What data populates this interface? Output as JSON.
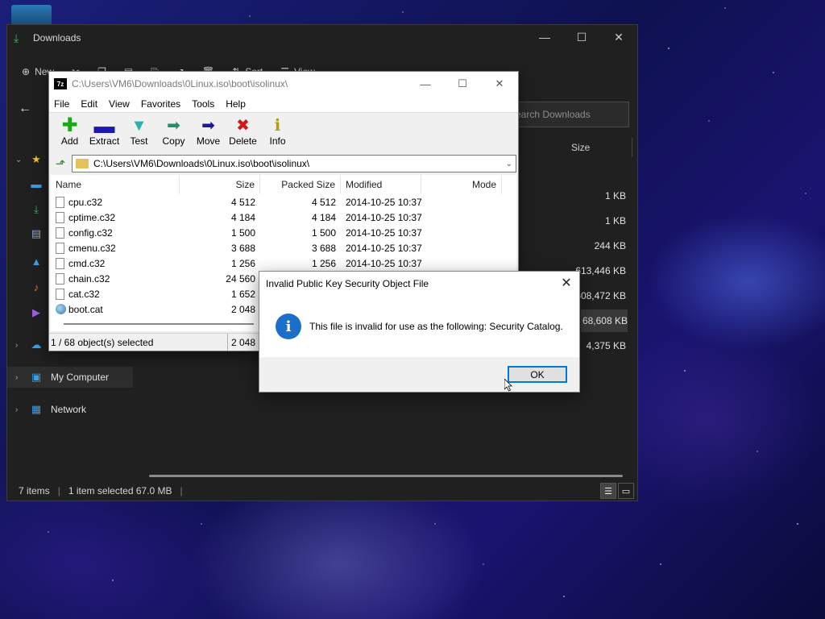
{
  "explorer": {
    "title": "Downloads",
    "toolbar": {
      "new_label": "New",
      "sort_label": "Sort",
      "view_label": "View"
    },
    "search_placeholder": "Search Downloads",
    "column_size": "Size",
    "sidebar": {
      "my_computer": "My Computer",
      "network": "Network"
    },
    "sizes": [
      "1 KB",
      "1 KB",
      "244 KB",
      "613,446 KB",
      "608,472 KB",
      "68,608 KB",
      "4,375 KB"
    ],
    "status": {
      "items": "7 items",
      "selected": "1 item selected  67.0 MB"
    }
  },
  "zip": {
    "title": "C:\\Users\\VM6\\Downloads\\0Linux.iso\\boot\\isolinux\\",
    "menu": [
      "File",
      "Edit",
      "View",
      "Favorites",
      "Tools",
      "Help"
    ],
    "tools": [
      "Add",
      "Extract",
      "Test",
      "Copy",
      "Move",
      "Delete",
      "Info"
    ],
    "address": "C:\\Users\\VM6\\Downloads\\0Linux.iso\\boot\\isolinux\\",
    "columns": [
      "Name",
      "Size",
      "Packed Size",
      "Modified",
      "Mode"
    ],
    "rows": [
      [
        "cpu.c32",
        "4 512",
        "4 512",
        "2014-10-25 10:37"
      ],
      [
        "cptime.c32",
        "4 184",
        "4 184",
        "2014-10-25 10:37"
      ],
      [
        "config.c32",
        "1 500",
        "1 500",
        "2014-10-25 10:37"
      ],
      [
        "cmenu.c32",
        "3 688",
        "3 688",
        "2014-10-25 10:37"
      ],
      [
        "cmd.c32",
        "1 256",
        "1 256",
        "2014-10-25 10:37"
      ],
      [
        "chain.c32",
        "24 560",
        "",
        ""
      ],
      [
        "cat.c32",
        "1 652",
        "",
        ""
      ],
      [
        "boot.cat",
        "2 048",
        "",
        ""
      ]
    ],
    "status": {
      "selection": "1 / 68 object(s) selected",
      "size": "2 048"
    }
  },
  "dialog": {
    "title": "Invalid Public Key Security Object File",
    "message": "This file is invalid for use as the following: Security Catalog.",
    "ok": "OK"
  }
}
